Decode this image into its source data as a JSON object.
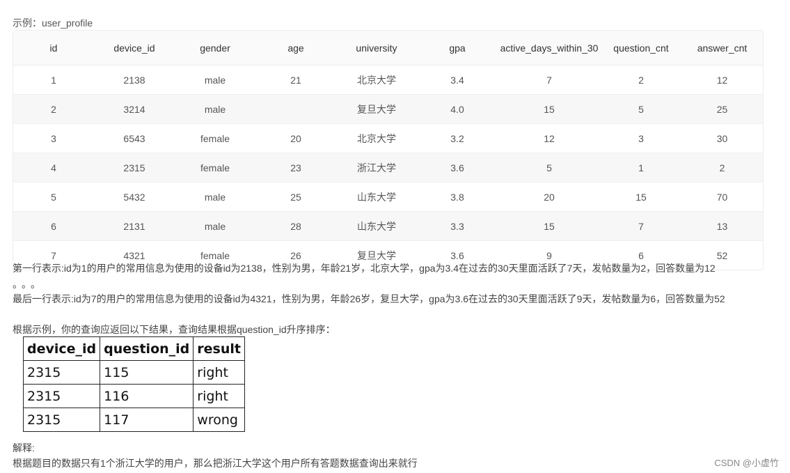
{
  "caption": "示例：user_profile",
  "user_profile": {
    "headers": [
      "id",
      "device_id",
      "gender",
      "age",
      "university",
      "gpa",
      "active_days_within_30",
      "question_cnt",
      "answer_cnt"
    ],
    "rows": [
      [
        "1",
        "2138",
        "male",
        "21",
        "北京大学",
        "3.4",
        "7",
        "2",
        "12"
      ],
      [
        "2",
        "3214",
        "male",
        "",
        "复旦大学",
        "4.0",
        "15",
        "5",
        "25"
      ],
      [
        "3",
        "6543",
        "female",
        "20",
        "北京大学",
        "3.2",
        "12",
        "3",
        "30"
      ],
      [
        "4",
        "2315",
        "female",
        "23",
        "浙江大学",
        "3.6",
        "5",
        "1",
        "2"
      ],
      [
        "5",
        "5432",
        "male",
        "25",
        "山东大学",
        "3.8",
        "20",
        "15",
        "70"
      ],
      [
        "6",
        "2131",
        "male",
        "28",
        "山东大学",
        "3.3",
        "15",
        "7",
        "13"
      ],
      [
        "7",
        "4321",
        "female",
        "26",
        "复旦大学",
        "3.6",
        "9",
        "6",
        "52"
      ]
    ]
  },
  "notes": {
    "first_row": "第一行表示:id为1的用户的常用信息为使用的设备id为2138，性别为男，年龄21岁，北京大学，gpa为3.4在过去的30天里面活跃了7天，发帖数量为2，回答数量为12",
    "ellipsis": "。。。",
    "last_row": "最后一行表示:id为7的用户的常用信息为使用的设备id为4321，性别为男，年龄26岁，复旦大学，gpa为3.6在过去的30天里面活跃了9天，发帖数量为6，回答数量为52",
    "result_intro": "根据示例，你的查询应返回以下结果，查询结果根据question_id升序排序：",
    "explain_label": "解释:",
    "explain_text": "根据题目的数据只有1个浙江大学的用户，那么把浙江大学这个用户所有答题数据查询出来就行"
  },
  "result_table": {
    "headers": [
      "device_id",
      "question_id",
      "result"
    ],
    "rows": [
      [
        "2315",
        "115",
        "right"
      ],
      [
        "2315",
        "116",
        "right"
      ],
      [
        "2315",
        "117",
        "wrong"
      ]
    ]
  },
  "watermark": "CSDN @小虚竹"
}
